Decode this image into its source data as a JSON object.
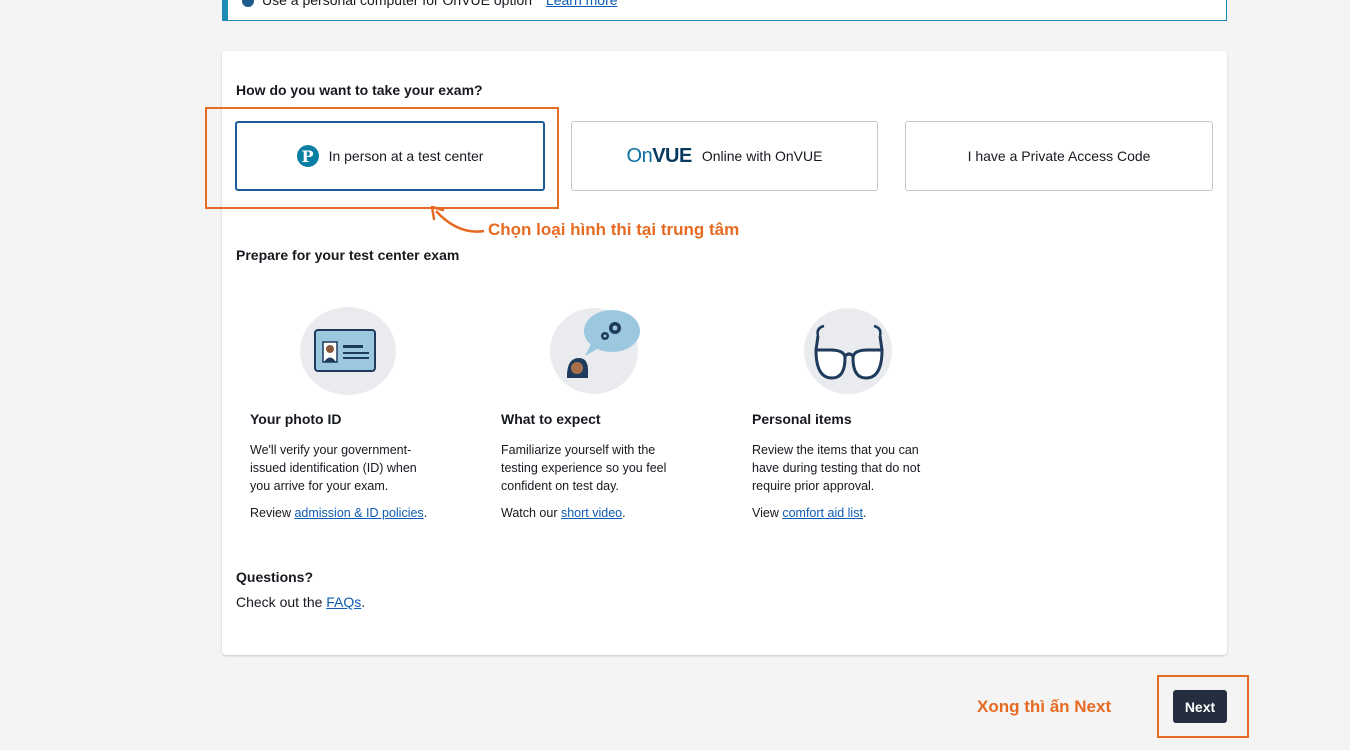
{
  "banner": {
    "text": "Use a personal computer for OnVUE option",
    "link": "Learn more"
  },
  "exam": {
    "question": "How do you want to take your exam?",
    "options": [
      {
        "label": "In person at a test center",
        "icon": "pearson-logo-icon",
        "selected": true
      },
      {
        "label": "Online with OnVUE",
        "icon": "onvue-logo-icon",
        "logo_text": "OnVUE",
        "selected": false
      },
      {
        "label": "I have a Private Access Code",
        "selected": false
      }
    ]
  },
  "prepare": {
    "heading": "Prepare for your test center exam",
    "items": [
      {
        "title": "Your photo ID",
        "description": "We'll verify your government-issued identification (ID) when you arrive for your exam.",
        "link_prefix": "Review ",
        "link_text": "admission & ID policies",
        "link_suffix": ".",
        "icon": "id-card-icon"
      },
      {
        "title": "What to expect",
        "description": "Familiarize yourself with the testing experience so you feel confident on test day.",
        "link_prefix": "Watch our ",
        "link_text": "short video",
        "link_suffix": ".",
        "icon": "person-thinking-icon"
      },
      {
        "title": "Personal items",
        "description": "Review the items that you can have during testing that do not require prior approval.",
        "link_prefix": "View ",
        "link_text": "comfort aid list",
        "link_suffix": ".",
        "icon": "glasses-icon"
      }
    ]
  },
  "questions": {
    "title": "Questions?",
    "text_prefix": "Check out the ",
    "link_text": "FAQs",
    "text_suffix": "."
  },
  "annotations": {
    "choose_test_center": "Chọn loại hình thi tại trung tâm",
    "press_next": "Xong thì ấn Next"
  },
  "footer": {
    "next_label": "Next"
  },
  "colors": {
    "accent": "#e66b22",
    "primary_button": "#232f3e",
    "selected_border": "#1b5b99",
    "link": "#0f5bb5"
  }
}
